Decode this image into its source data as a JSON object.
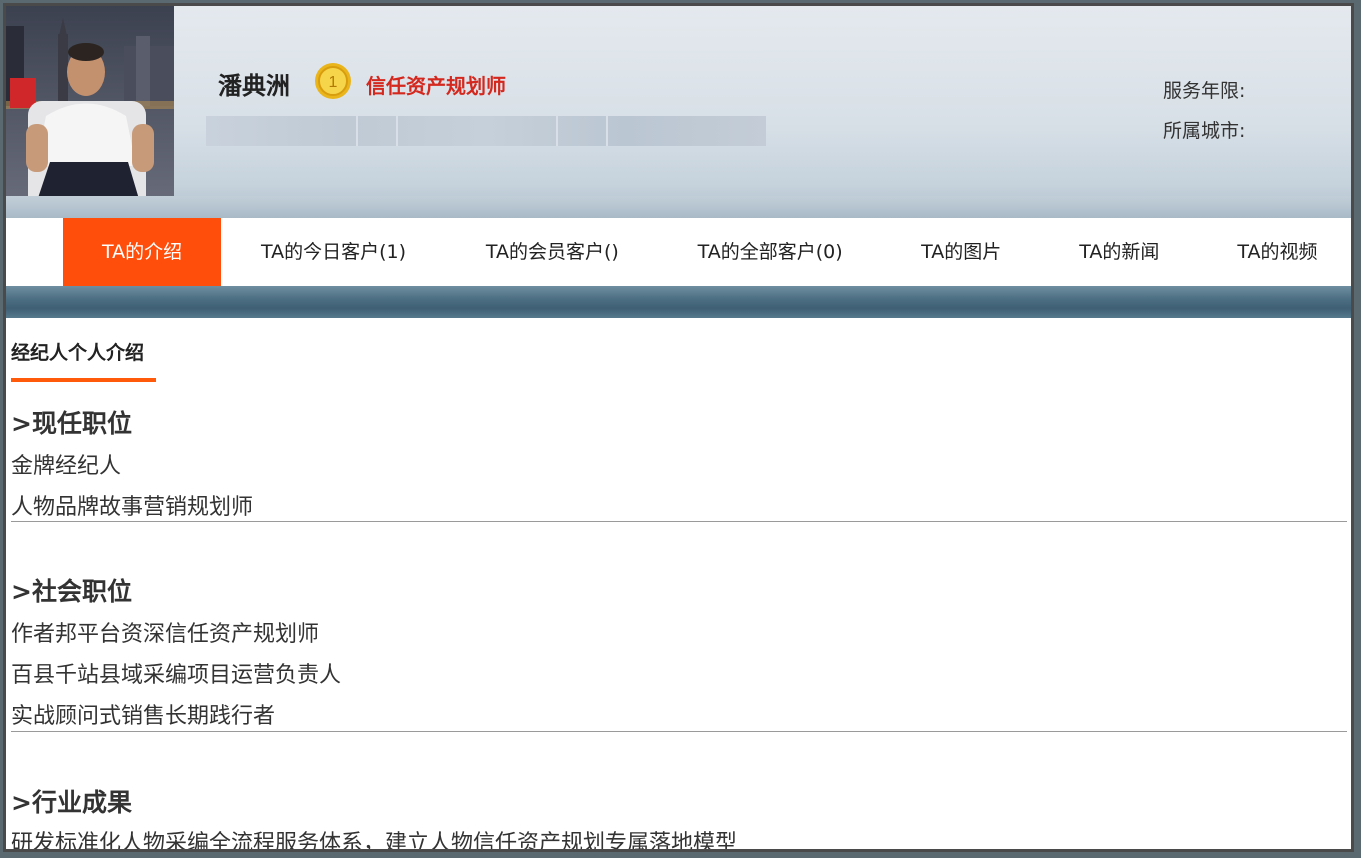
{
  "profile": {
    "name": "潘典洲",
    "title": "信任资产规划师",
    "service_years_label": "服务年限:",
    "city_label": "所属城市:",
    "medal_number": "1"
  },
  "tabs": [
    {
      "label": "TA的介绍",
      "active": true
    },
    {
      "label": "TA的今日客户(1)",
      "active": false
    },
    {
      "label": "TA的会员客户()",
      "active": false
    },
    {
      "label": "TA的全部客户(0)",
      "active": false
    },
    {
      "label": "TA的图片",
      "active": false
    },
    {
      "label": "TA的新闻",
      "active": false
    },
    {
      "label": "TA的视频",
      "active": false
    }
  ],
  "intro": {
    "heading": "经纪人个人介绍",
    "sections": [
      {
        "title": ">现任职位",
        "lines": [
          "金牌经纪人",
          "人物品牌故事营销规划师"
        ]
      },
      {
        "title": ">社会职位",
        "lines": [
          "作者邦平台资深信任资产规划师",
          "百县千站县域采编项目运营负责人",
          "实战顾问式销售长期践行者"
        ]
      },
      {
        "title": ">行业成果",
        "lines": [
          "研发标准化人物采编全流程服务体系，建立人物信任资产规划专属落地模型"
        ]
      }
    ]
  },
  "colors": {
    "accent": "#ff4e0b",
    "title_red": "#d4281e"
  }
}
